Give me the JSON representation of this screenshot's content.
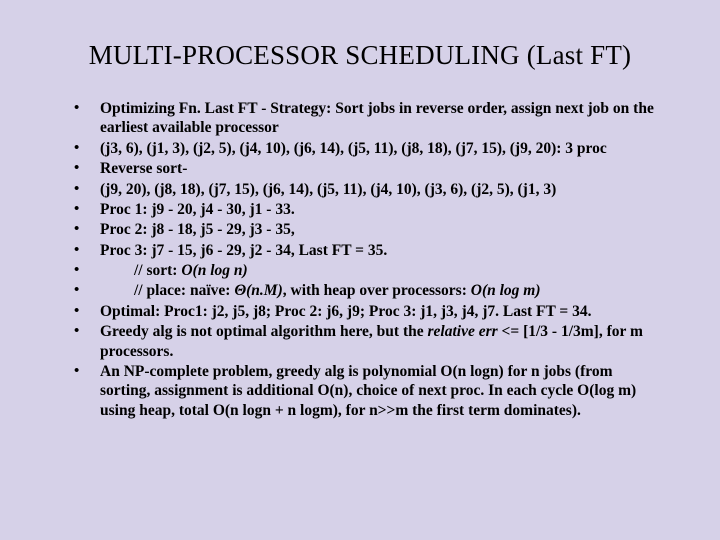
{
  "title": "MULTI-PROCESSOR SCHEDULING (Last FT)",
  "bullets": {
    "b0": "Optimizing Fn. Last FT - Strategy: Sort jobs in reverse order, assign next job on the earliest available processor",
    "b1": "(j3, 6), (j1, 3), (j2, 5), (j4, 10), (j6, 14), (j5, 11), (j8, 18), (j7, 15), (j9, 20): 3 proc",
    "b2": "Reverse sort-",
    "b3": "(j9, 20), (j8, 18), (j7, 15), (j6, 14), (j5, 11), (j4, 10), (j3, 6), (j2, 5), (j1, 3)",
    "b4": "Proc 1:  j9 - 20, j4 - 30, j1 - 33.",
    "b5": "Proc 2:  j8 - 18, j5 - 29, j3 - 35,",
    "b6": "Proc 3:  j7 - 15, j6 - 29, j2 - 34,     Last FT = 35.",
    "b7_prefix": "// sort: ",
    "b7_ital": "O(n log n)",
    "b8_prefix": "// place: naïve: ",
    "b8_theta": "Θ(n.M)",
    "b8_mid": ", with heap over processors: ",
    "b8_ital2": "O(n log m)",
    "b9": "Optimal: Proc1: j2, j5, j8; Proc 2: j6, j9; Proc 3: j1, j3, j4, j7.  Last FT = 34.",
    "b10_a": "Greedy alg is not optimal algorithm here, but the ",
    "b10_rel": "relative err",
    "b10_b": " <= [1/3 - 1/3m], for m processors.",
    "b11": "An NP-complete problem, greedy alg is polynomial O(n logn) for n jobs (from sorting, assignment is additional O(n), choice of next proc. In each cycle O(log m) using heap, total O(n logn + n logm), for n>>m the first term dominates)."
  }
}
